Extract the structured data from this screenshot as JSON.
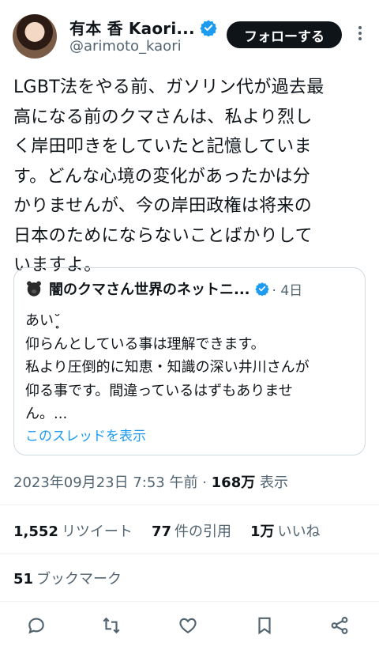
{
  "author": {
    "display_name": "有本 香 Kaori...",
    "handle": "@arimoto_kaori",
    "follow_label": "フォローする"
  },
  "tweet": {
    "text": "LGBT法をやる前、ガソリン代が過去最\n高になる前のクマさんは、私より烈し\nく岸田叩きをしていたと記憶していま\nす。どんな心境の変化があったかは分\nかりませんが、今の岸田政権は将来の\n日本のためにならないことばかりして\nいますよ。"
  },
  "quote": {
    "name": "闇のクマさん世界のネットニ...",
    "time": "· 4日",
    "body": "あい˘̥\n仰らんとしている事は理解できます。\n私より圧倒的に知恵・知識の深い井川さんが\n仰る事です。間違っているはずもありませ\nん。...",
    "thread_link": "このスレッドを表示"
  },
  "meta": {
    "date": "2023年09月23日 7:53 午前 · ",
    "views_count": "168万",
    "views_label": " 表示"
  },
  "stats": {
    "retweets_count": "1,552",
    "retweets_label": "リツイート",
    "quotes_count": "77",
    "quotes_label": "件の引用",
    "likes_count": "1万",
    "likes_label": "いいね"
  },
  "bookmarks": {
    "count": "51",
    "label": "ブックマーク"
  },
  "icons": {
    "verified": "verified-badge-icon",
    "more": "more-vertical-icon",
    "reply": "reply-icon",
    "retweet": "retweet-icon",
    "like": "heart-icon",
    "bookmark": "bookmark-icon",
    "share": "share-icon"
  },
  "colors": {
    "accent": "#1d9bf0",
    "text": "#0f1419",
    "secondary": "#536471",
    "follow_bg": "#0f1419"
  }
}
